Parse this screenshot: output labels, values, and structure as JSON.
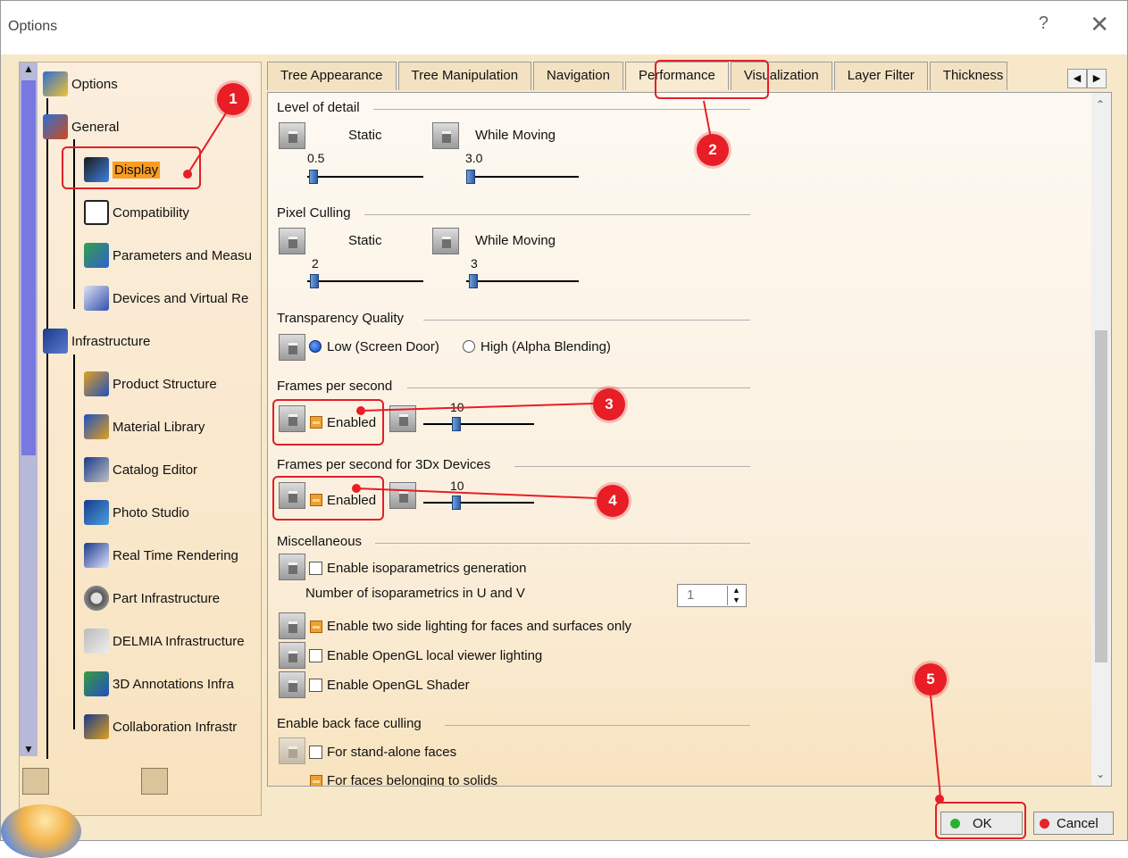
{
  "window": {
    "title": "Options",
    "help": "?",
    "close": "✕"
  },
  "tree": {
    "root": "Options",
    "general": "General",
    "items_general": [
      "Display",
      "Compatibility",
      "Parameters and Measu",
      "Devices and Virtual Re"
    ],
    "infrastructure": "Infrastructure",
    "items_infra": [
      "Product Structure",
      "Material Library",
      "Catalog Editor",
      "Photo Studio",
      "Real Time Rendering",
      "Part Infrastructure",
      "DELMIA Infrastructure",
      "3D Annotations Infra",
      "Collaboration Infrastr"
    ]
  },
  "tabs": [
    "Tree Appearance",
    "Tree Manipulation",
    "Navigation",
    "Performance",
    "Visualization",
    "Layer Filter",
    "Thickness"
  ],
  "active_tab": "Performance",
  "lod": {
    "label": "Level of detail",
    "static": "Static",
    "moving": "While Moving",
    "static_val": "0.5",
    "moving_val": "3.0"
  },
  "culling": {
    "label": "Pixel Culling",
    "static": "Static",
    "moving": "While Moving",
    "static_val": "2",
    "moving_val": "3"
  },
  "transparency": {
    "label": "Transparency Quality",
    "low": "Low (Screen Door)",
    "high": "High (Alpha Blending)",
    "selected": "low"
  },
  "fps": {
    "label": "Frames per second",
    "enabled": "Enabled",
    "value": "10"
  },
  "fps3dx": {
    "label": "Frames per second for 3Dx Devices",
    "enabled": "Enabled",
    "value": "10"
  },
  "misc": {
    "label": "Miscellaneous",
    "iso": "Enable isoparametrics generation",
    "iso_count_label": "Number of isoparametrics in U and V",
    "iso_count": "1",
    "two_side": "Enable two side lighting for faces and surfaces only",
    "local_viewer": "Enable OpenGL local viewer lighting",
    "shader": "Enable OpenGL Shader"
  },
  "backface": {
    "label": "Enable back face culling",
    "standalone": "For stand-alone faces",
    "solids": "For faces belonging to solids"
  },
  "annotations": [
    "1",
    "2",
    "3",
    "4",
    "5"
  ],
  "buttons": {
    "ok": "OK",
    "cancel": "Cancel"
  },
  "colors": {
    "annotation": "#e81d25",
    "selection": "#f79d24",
    "ok_led": "#29b02c",
    "cancel_led": "#e8232a"
  }
}
